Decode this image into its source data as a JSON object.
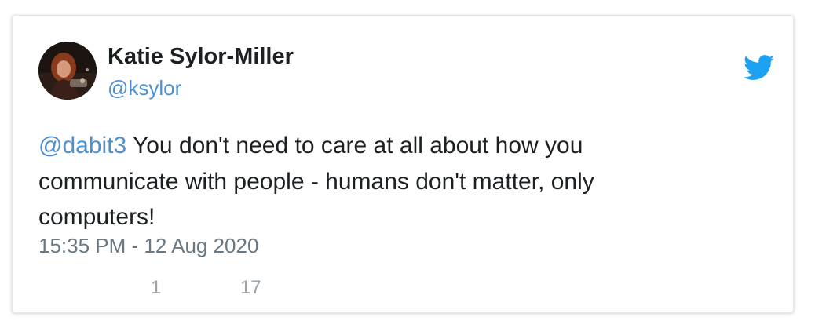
{
  "author": {
    "display_name": "Katie Sylor-Miller",
    "handle": "@ksylor"
  },
  "tweet": {
    "mention": "@dabit3",
    "text": " You don't need to care at all about how you communicate with people - humans don't matter, only computers!",
    "timestamp": "15:35 PM - 12 Aug 2020"
  },
  "stats": {
    "replies": "1",
    "likes": "17"
  },
  "icons": {
    "brand": "twitter-bird-icon",
    "replies": "reply-icon",
    "likes": "heart-icon"
  },
  "colors": {
    "link": "#4e8fce",
    "brand": "#1da1f2",
    "text": "#1c2022",
    "muted": "#697882"
  }
}
